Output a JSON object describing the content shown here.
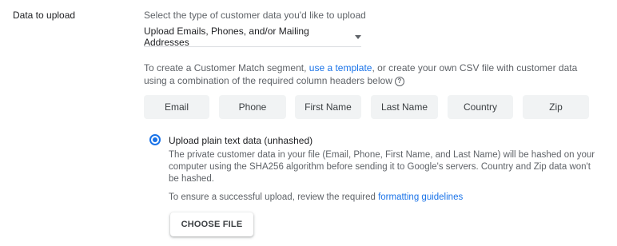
{
  "section": {
    "label": "Data to upload",
    "instruction": "Select the type of customer data you'd like to upload"
  },
  "dropdown": {
    "value": "Upload Emails, Phones, and/or Mailing Addresses",
    "icon": "arrow-drop-down-icon"
  },
  "template_text": {
    "before_link": "To create a Customer Match segment, ",
    "link": "use a template",
    "after_link": ", or create your own CSV file with customer data using a combination of the required column headers below",
    "help_icon": "?"
  },
  "chips": [
    "Email",
    "Phone",
    "First Name",
    "Last Name",
    "Country",
    "Zip"
  ],
  "radio": {
    "label": "Upload plain text data (unhashed)",
    "selected": true,
    "description": "The private customer data in your file (Email, Phone, First Name, and Last Name) will be hashed on your computer using the SHA256 algorithm before sending it to Google's servers. Country and Zip data won't be hashed."
  },
  "upload_note": {
    "before_link": "To ensure a successful upload, review the required ",
    "link": "formatting guidelines"
  },
  "choose_file_label": "CHOOSE FILE",
  "colors": {
    "accent": "#1a73e8",
    "chip_bg": "#f1f3f4",
    "text_secondary": "#5f6368"
  }
}
